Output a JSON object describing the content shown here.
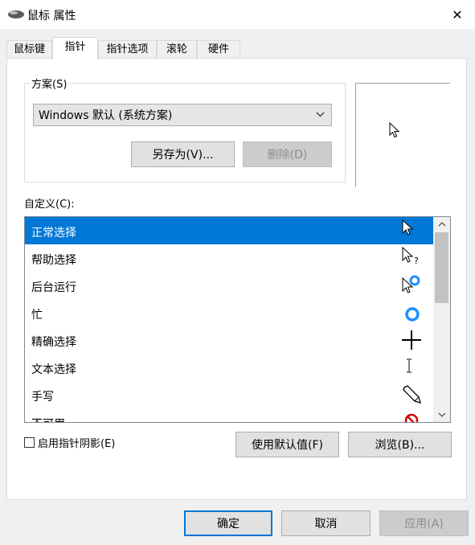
{
  "window": {
    "title": "鼠标 属性",
    "close_glyph": "✕"
  },
  "tabs": [
    {
      "label": "鼠标键",
      "active": false
    },
    {
      "label": "指针",
      "active": true
    },
    {
      "label": "指针选项",
      "active": false
    },
    {
      "label": "滚轮",
      "active": false
    },
    {
      "label": "硬件",
      "active": false
    }
  ],
  "scheme": {
    "group_label": "方案(S)",
    "selected": "Windows 默认 (系统方案)",
    "save_as_label": "另存为(V)...",
    "delete_label": "删除(D)"
  },
  "preview": {
    "icon": "arrow-cursor-icon"
  },
  "customize": {
    "label": "自定义(C):",
    "items": [
      {
        "label": "正常选择",
        "icon": "normal-select-cursor-icon",
        "selected": true
      },
      {
        "label": "帮助选择",
        "icon": "help-select-cursor-icon",
        "selected": false
      },
      {
        "label": "后台运行",
        "icon": "working-in-background-cursor-icon",
        "selected": false
      },
      {
        "label": "忙",
        "icon": "busy-cursor-icon",
        "selected": false
      },
      {
        "label": "精确选择",
        "icon": "precision-select-cursor-icon",
        "selected": false
      },
      {
        "label": "文本选择",
        "icon": "text-select-cursor-icon",
        "selected": false
      },
      {
        "label": "手写",
        "icon": "handwriting-cursor-icon",
        "selected": false
      },
      {
        "label": "不可用",
        "icon": "unavailable-cursor-icon",
        "selected": false
      }
    ]
  },
  "options": {
    "shadow_checkbox_label": "启用指针阴影(E)",
    "shadow_checked": false,
    "use_default_label": "使用默认值(F)",
    "browse_label": "浏览(B)..."
  },
  "footer": {
    "ok_label": "确定",
    "cancel_label": "取消",
    "apply_label": "应用(A)"
  },
  "colors": {
    "selection": "#0078d7",
    "busy_ring": "#1e90ff",
    "unavailable": "#d40000"
  }
}
